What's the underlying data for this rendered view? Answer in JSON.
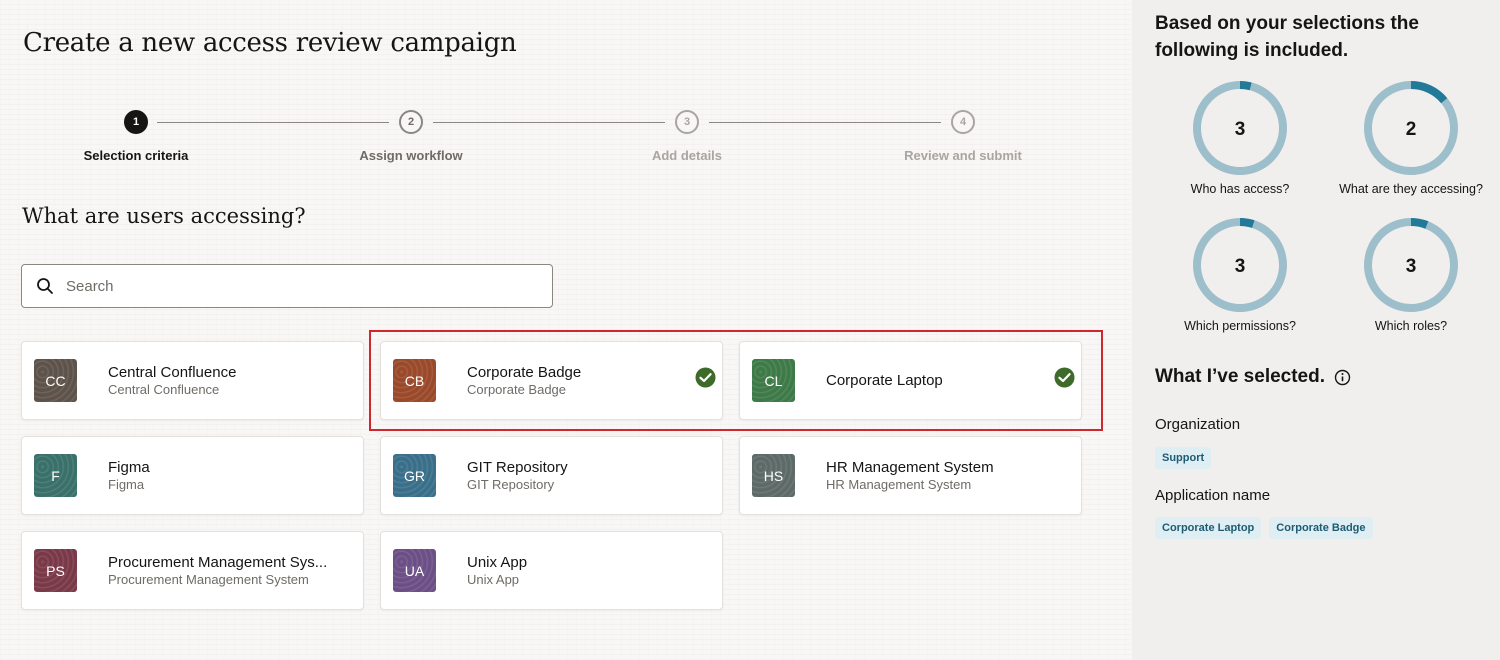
{
  "page": {
    "title": "Create a new access review campaign"
  },
  "stepper": {
    "steps": [
      {
        "number": "1",
        "label": "Selection criteria",
        "state": "active"
      },
      {
        "number": "2",
        "label": "Assign workflow",
        "state": "upcoming"
      },
      {
        "number": "3",
        "label": "Add details",
        "state": "future"
      },
      {
        "number": "4",
        "label": "Review and submit",
        "state": "future"
      }
    ]
  },
  "main": {
    "section_title": "What are users accessing?",
    "search": {
      "placeholder": "Search",
      "value": ""
    },
    "cards": [
      {
        "initials": "CC",
        "name": "Central Confluence",
        "subtitle": "Central Confluence",
        "color": "#5e534a",
        "selected": false
      },
      {
        "initials": "CB",
        "name": "Corporate Badge",
        "subtitle": "Corporate Badge",
        "color": "#9a4a2a",
        "selected": true
      },
      {
        "initials": "CL",
        "name": "Corporate Laptop",
        "subtitle": "",
        "color": "#3e7a48",
        "selected": true
      },
      {
        "initials": "F",
        "name": "Figma",
        "subtitle": "Figma",
        "color": "#3a706a",
        "selected": false
      },
      {
        "initials": "GR",
        "name": "GIT Repository",
        "subtitle": "GIT Repository",
        "color": "#3a6f8a",
        "selected": false
      },
      {
        "initials": "HS",
        "name": "HR Management System",
        "subtitle": "HR Management System",
        "color": "#5d6a68",
        "selected": false
      },
      {
        "initials": "PS",
        "name": "Procurement Management Sys...",
        "subtitle": "Procurement Management System",
        "color": "#7a3948",
        "selected": false
      },
      {
        "initials": "UA",
        "name": "Unix App",
        "subtitle": "Unix App",
        "color": "#6c4f86",
        "selected": false
      }
    ],
    "check_color": "#3f6b2a"
  },
  "side": {
    "title": "Based on your selections the following is included.",
    "summary": [
      {
        "value": "3",
        "label": "Who has access?",
        "fraction": 0.04
      },
      {
        "value": "2",
        "label": "What are they accessing?",
        "fraction": 0.14
      },
      {
        "value": "3",
        "label": "Which permissions?",
        "fraction": 0.05
      },
      {
        "value": "3",
        "label": "Which roles?",
        "fraction": 0.06
      }
    ],
    "ring_color": "#9dbecb",
    "ring_accent": "#227a98",
    "selected_title": "What I’ve selected.",
    "info_icon": "info-icon",
    "groups": [
      {
        "label": "Organization",
        "chips": [
          "Support"
        ]
      },
      {
        "label": "Application name",
        "chips": [
          "Corporate Laptop",
          "Corporate Badge"
        ]
      }
    ]
  }
}
